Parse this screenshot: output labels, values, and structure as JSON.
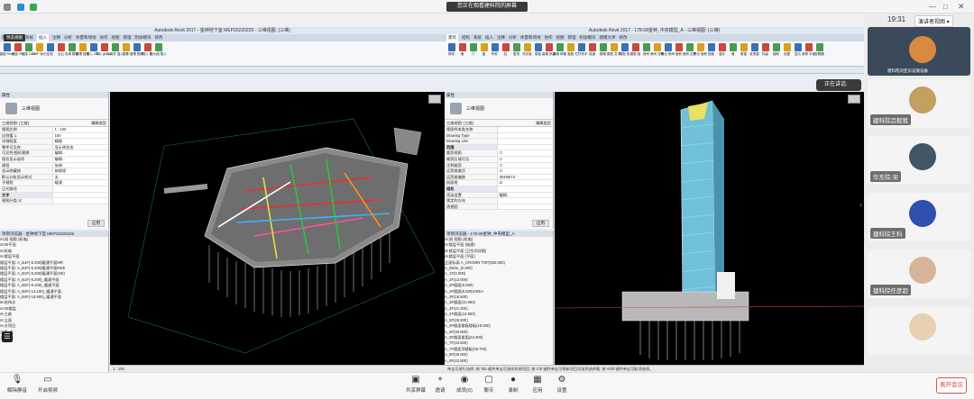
{
  "meeting": {
    "share_banner": "您正在观看建科院的屏幕",
    "clock": "19:31",
    "speaker_view_label": "演讲者视图",
    "speaking_label": "正在讲话:",
    "speaking_name": "建科院刘亚东设施设备"
  },
  "participants": [
    {
      "name": "建科院吕毅我",
      "avatar_color": "#c4a060"
    },
    {
      "name": "华东院-宋",
      "avatar_color": "#445566"
    },
    {
      "name": "建科院王科",
      "avatar_color": "#3050b0"
    },
    {
      "name": "建科院任彦超",
      "avatar_color": "#d7b59c"
    },
    {
      "name": "",
      "avatar_color": "#e8d0b0"
    }
  ],
  "bottom_toolbar": {
    "left": [
      {
        "label": "解除静音",
        "icon": "mic-icon"
      },
      {
        "label": "开启视频",
        "icon": "video-icon"
      }
    ],
    "center": [
      {
        "label": "共享屏幕",
        "icon": "screen-share-icon"
      },
      {
        "label": "邀请",
        "icon": "invite-icon"
      },
      {
        "label": "成员(6)",
        "icon": "members-icon"
      },
      {
        "label": "聊天",
        "icon": "chat-icon"
      },
      {
        "label": "录制",
        "icon": "record-icon"
      },
      {
        "label": "应用",
        "icon": "apps-icon"
      },
      {
        "label": "设置",
        "icon": "gear-icon"
      }
    ],
    "leave_label": "离开会议"
  },
  "left_window": {
    "title": "Autodesk Revit 2017 -    金钟地下室 MEP20220225 - 三维视图: {三维}",
    "tabs": [
      "建筑",
      "结构",
      "系统",
      "插入",
      "注释",
      "分析",
      "体量和场地",
      "协作",
      "视图",
      "管理",
      "附加模块",
      "修改"
    ],
    "active_tab": "插入",
    "tooltip": "预览视图",
    "ribbon_buttons": [
      "链接 Revit",
      "链接 IFC",
      "链接 CAD",
      "DWF 标记",
      "贴花",
      "点云",
      "协调 模型",
      "管理 链接",
      "导入 CAD",
      "导入 gbXML",
      "从文件 插入",
      "图像",
      "管理 图像",
      "载入 族",
      "作为组 载入"
    ],
    "ribbon_groups": [
      "链接",
      "导入",
      "从库中载入"
    ],
    "props_header": "属性",
    "view_type": "三维视图",
    "view_dropdown": "三维视图: {三维}",
    "edit_type": "编辑类型",
    "props": [
      {
        "k": "视图比例",
        "v": "1 : 100"
      },
      {
        "k": "比例值 1:",
        "v": "100"
      },
      {
        "k": "详细程度",
        "v": "精细"
      },
      {
        "k": "零件可见性",
        "v": "显示原状态"
      },
      {
        "k": "可见性/图形替换",
        "v": "编辑..."
      },
      {
        "k": "图形显示选项",
        "v": "编辑..."
      },
      {
        "k": "规程",
        "v": "协调"
      },
      {
        "k": "显示隐藏线",
        "v": "按规程"
      },
      {
        "k": "默认分析显示样式",
        "v": "无"
      },
      {
        "k": "子规程",
        "v": "暖通"
      },
      {
        "k": "日光路径",
        "v": ""
      },
      {
        "k": "文字",
        "v": "",
        "sec": true
      },
      {
        "k": "视图分类-父",
        "v": ""
      }
    ],
    "apply": "应用",
    "browser_header": "项目浏览器 - 金钟地下室 MEP20220225",
    "tree": [
      "⊟ [0] 视图 (机电)",
      "  ⊟ 00平面",
      "    ⊟ 机电",
      "      ⊟ 楼层平面",
      "        楼层平面: A_B1F(-5.200)暖通平面MR",
      "        楼层平面: A_B1F(-5.200)暖通平面MSE",
      "        楼层平面: A_B1F(-5.200)暖通平面(NE)",
      "        楼层平面: A_B1F(-5.200)_暖通平面",
      "        楼层平面: A_B2F(-9.100)_暖通平面",
      "        楼层平面: A_B3F(-13.100)_暖通平面",
      "        楼层平面: A_B4F(-16.900)_暖通平面",
      "    ⊞ 给排水",
      "  ⊟ 00楼层",
      "    ⊟ 三维",
      "    ⊟ 立面",
      "      ⊟ 分项目",
      "        立面: 东",
      "        立面: 北"
    ],
    "status": "1 : 100"
  },
  "right_window": {
    "title": "Autodesk Revit 2017 -    178-08金钟_中央模型_A - 三维视图: {三维}",
    "tabs": [
      "建筑",
      "结构",
      "系统",
      "插入",
      "注释",
      "分析",
      "体量和场地",
      "协作",
      "视图",
      "管理",
      "附加模块",
      "建模大师",
      "修改"
    ],
    "active_tab": "建筑",
    "ribbon_buttons": [
      "修改",
      "墙",
      "门",
      "窗",
      "构件",
      "柱",
      "屋顶",
      "天花板",
      "楼板",
      "幕墙 系统",
      "幕墙 网格",
      "竖梃",
      "栏杆扶手",
      "坡道",
      "楼梯",
      "模型 文字",
      "模型 线",
      "模型 组",
      "房间",
      "房间 分隔",
      "标记 房间",
      "面积",
      "面积 边界",
      "标记 面积",
      "按面",
      "竖井",
      "墙",
      "垂直",
      "老虎窗",
      "标高",
      "轴网",
      "设置",
      "显示",
      "参照 平面",
      "查看器"
    ],
    "ribbon_groups": [
      "选择",
      "构建",
      "楼梯坡道",
      "模型",
      "房间和面积",
      "洞口",
      "基准",
      "工作平面"
    ],
    "props_header": "属性",
    "view_type": "三维视图",
    "view_dropdown": "三维视图: {三维}",
    "edit_type": "编辑类型",
    "props": [
      {
        "k": "视图样本类名称",
        "v": ""
      },
      {
        "k": "Drawing Type",
        "v": ""
      },
      {
        "k": "Drawing Use",
        "v": ""
      },
      {
        "k": "范围",
        "v": "",
        "sec": true
      },
      {
        "k": "裁剪视图",
        "v": "☐"
      },
      {
        "k": "裁剪区域可见",
        "v": "☐"
      },
      {
        "k": "注释裁剪",
        "v": "☐"
      },
      {
        "k": "远剪裁激活",
        "v": "☐"
      },
      {
        "k": "远剪裁偏移",
        "v": "304800.0"
      },
      {
        "k": "剖面框",
        "v": "☑"
      },
      {
        "k": "相机",
        "v": "",
        "sec": true
      },
      {
        "k": "渲染设置",
        "v": "编辑..."
      },
      {
        "k": "锁定的方向",
        "v": ""
      },
      {
        "k": "透视图",
        "v": ""
      }
    ],
    "apply": "应用",
    "browser_header": "项目浏览器 - 178-08金钟_中央模型_A",
    "tree": [
      "⊟ [0] 视图 (机电)",
      "  ⊟ 楼层平面 (结建)",
      "  ⊞ 楼层平面 (卫生间详图)",
      "  ⊟ 楼层平面 (平面)",
      "      立面标高 A_CROWN TOP(250.000)",
      "      A_Dahe_(0.000)",
      "      A_1F(0.000)",
      "      A_2F(12.000)",
      "      A_2F楼面(5.500)",
      "      A_2F楼面(5.500)AREA",
      "      A_3F(16.500)",
      "      A_3F楼面(10.000)",
      "      A_4F(21.000)",
      "      A_4F楼面(14.500)",
      "      A_5F(25.500)",
      "      A_5F楼面楼板楼板(19.000)",
      "      A_6F(30.000)",
      "      A_6F楼面楼面(23.400)",
      "      A_7F(34.500)",
      "      A_7F楼面顶楼板(28.700)",
      "      A_8F(39.000)",
      "      A_9F(43.500)"
    ],
    "status": "单击可进行选择; 按 Tab 键并单击可选择其他项目; 按 Ctrl 键并单击可将新项目添加到选择集; 按 Shift 键并单击可取消选择。"
  },
  "colors": {
    "viewport_bg": "#000000",
    "ribbon_blue": "#3d6fb3",
    "leave_red": "#e04040"
  }
}
